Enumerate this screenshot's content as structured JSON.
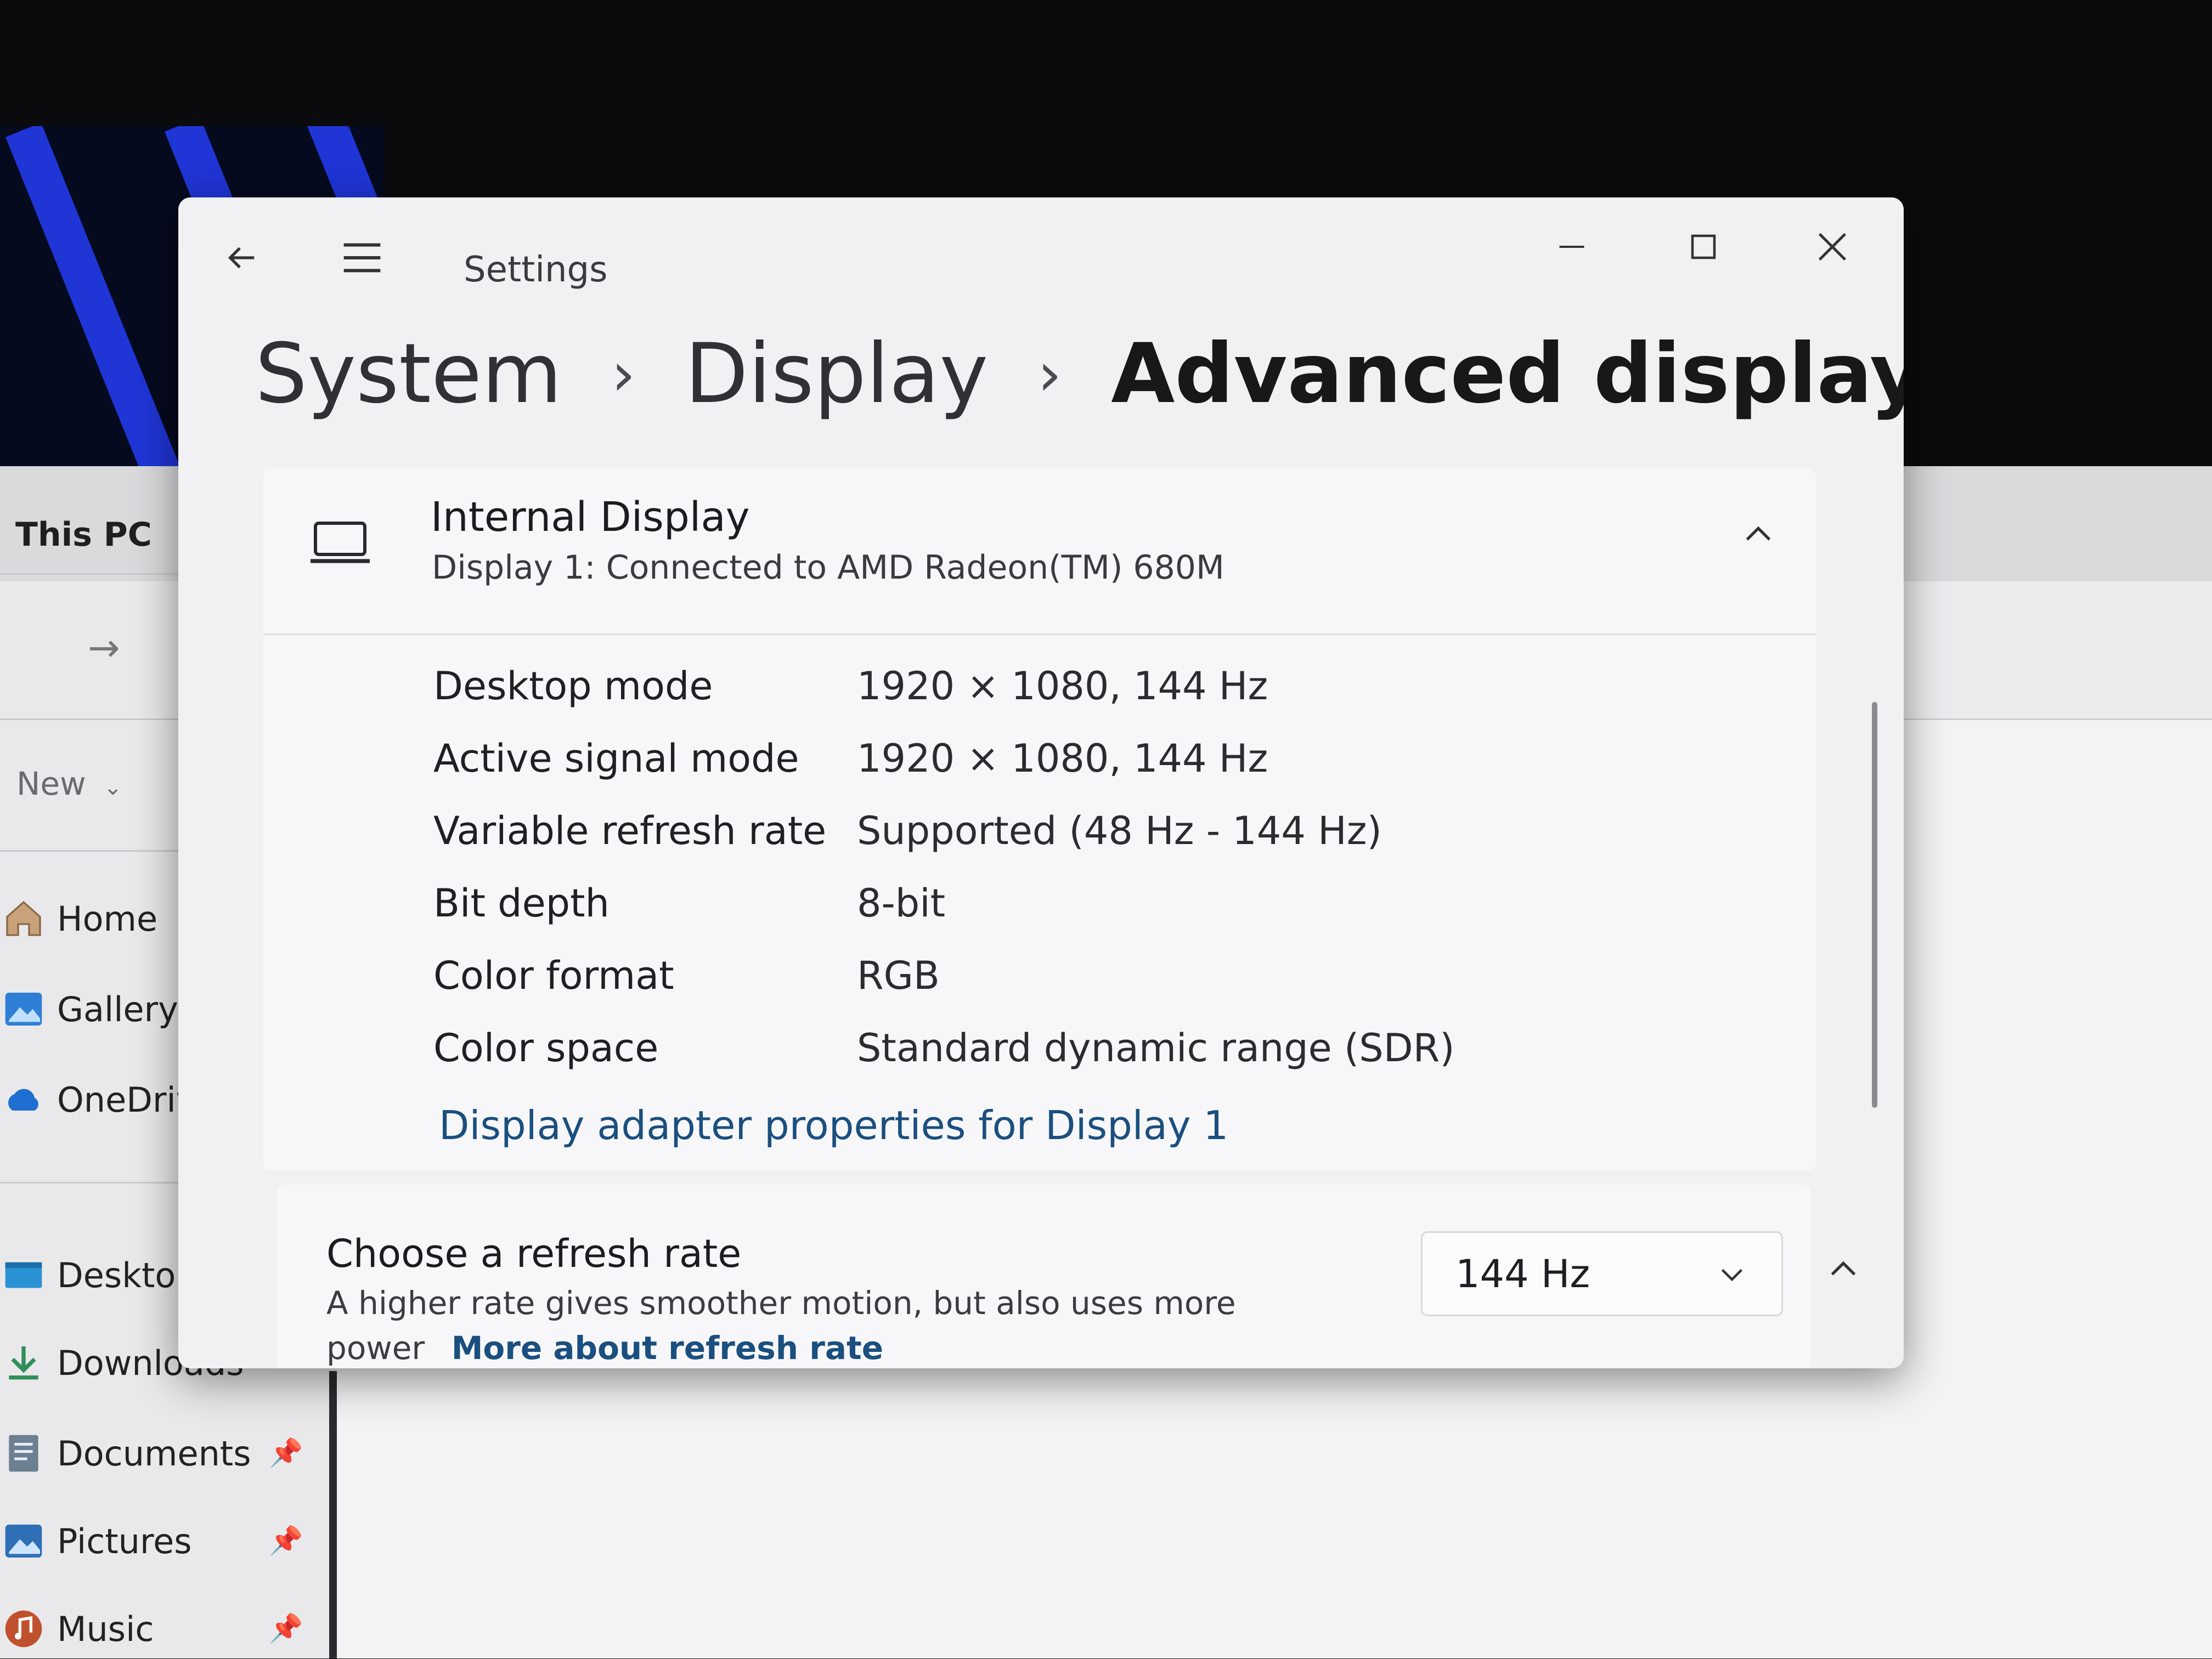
{
  "explorer": {
    "location": "This PC",
    "new_label": "New",
    "nav_items": [
      {
        "label": "Home",
        "icon": "home-icon"
      },
      {
        "label": "Gallery",
        "icon": "gallery-icon"
      },
      {
        "label": "OneDrive",
        "icon": "onedrive-icon"
      }
    ],
    "quick_access": [
      {
        "label": "Desktop",
        "icon": "desktop-folder-icon",
        "pinned": false
      },
      {
        "label": "Downloads",
        "icon": "download-icon",
        "pinned": false
      },
      {
        "label": "Documents",
        "icon": "documents-icon",
        "pinned": true
      },
      {
        "label": "Pictures",
        "icon": "pictures-icon",
        "pinned": true
      },
      {
        "label": "Music",
        "icon": "music-icon",
        "pinned": true
      }
    ]
  },
  "settings": {
    "app_title": "Settings",
    "breadcrumb": [
      "System",
      "Display",
      "Advanced display"
    ],
    "display": {
      "title": "Internal Display",
      "subtitle": "Display 1: Connected to AMD Radeon(TM) 680M",
      "properties": [
        {
          "label": "Desktop mode",
          "value": "1920 × 1080, 144 Hz"
        },
        {
          "label": "Active signal mode",
          "value": "1920 × 1080, 144 Hz"
        },
        {
          "label": "Variable refresh rate",
          "value": "Supported (48 Hz - 144 Hz)"
        },
        {
          "label": "Bit depth",
          "value": "8-bit"
        },
        {
          "label": "Color format",
          "value": "RGB"
        },
        {
          "label": "Color space",
          "value": "Standard dynamic range (SDR)"
        }
      ],
      "adapter_link": "Display adapter properties for Display 1"
    },
    "refresh_rate": {
      "title": "Choose a refresh rate",
      "description": "A higher rate gives smoother motion, but also uses more power",
      "more_link": "More about refresh rate",
      "selected": "144 Hz"
    }
  },
  "colors": {
    "link": "#1a4f7f",
    "window_bg": "#f1f1f3",
    "wallpaper_stripe": "#1f35d6"
  }
}
